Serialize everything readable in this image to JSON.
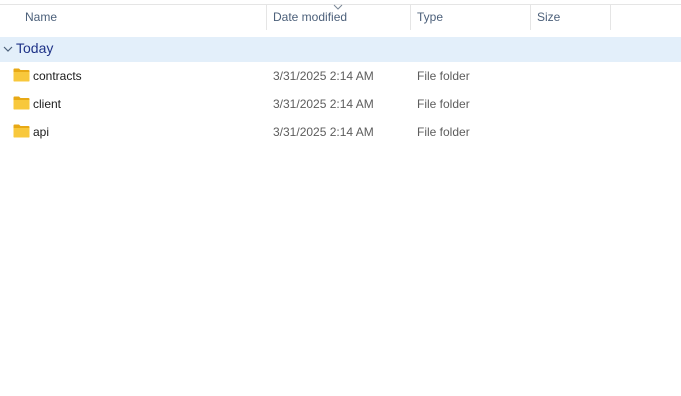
{
  "columns": {
    "name": "Name",
    "date_modified": "Date modified",
    "type": "Type",
    "size": "Size"
  },
  "sort": {
    "column": "date_modified",
    "icon": "chevron-down-icon"
  },
  "group": {
    "label": "Today",
    "icon": "chevron-down-icon"
  },
  "rows": [
    {
      "name": "contracts",
      "date_modified": "3/31/2025 2:14 AM",
      "type": "File folder",
      "size": "",
      "icon": "folder-icon"
    },
    {
      "name": "client",
      "date_modified": "3/31/2025 2:14 AM",
      "type": "File folder",
      "size": "",
      "icon": "folder-icon"
    },
    {
      "name": "api",
      "date_modified": "3/31/2025 2:14 AM",
      "type": "File folder",
      "size": "",
      "icon": "folder-icon"
    }
  ],
  "colors": {
    "group_background": "#e3effa",
    "group_text": "#1e3287",
    "header_text": "#4c607a",
    "folder_yellow": "#f8c83c"
  }
}
